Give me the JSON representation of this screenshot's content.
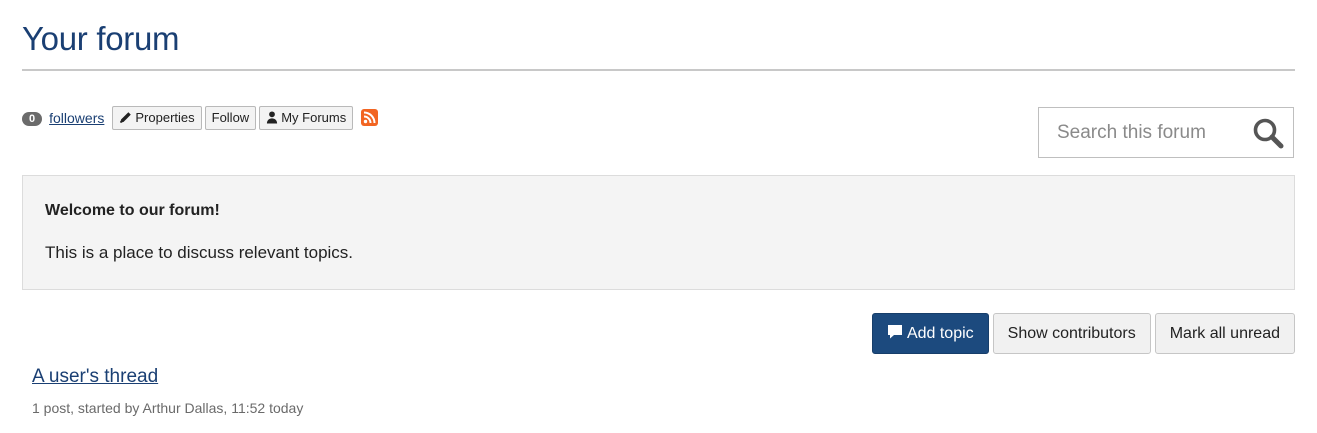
{
  "forum": {
    "title": "Your forum"
  },
  "toolbar": {
    "follower_count": "0",
    "followers_label": "followers",
    "properties_label": "Properties",
    "follow_label": "Follow",
    "my_forums_label": "My Forums",
    "rss_icon": "rss-icon"
  },
  "search": {
    "placeholder": "Search this forum",
    "value": "",
    "icon": "search-icon"
  },
  "intro": {
    "heading": "Welcome to our forum!",
    "text": "This is a place to discuss relevant topics."
  },
  "actions": {
    "add_topic_label": "Add topic",
    "show_contributors_label": "Show contributors",
    "mark_all_unread_label": "Mark all unread"
  },
  "threads": [
    {
      "title": "A user's thread",
      "meta": "1 post, started by Arthur Dallas, 11:52 today"
    }
  ],
  "colors": {
    "accent": "#1c4a7e",
    "title": "#1a3f73",
    "rss": "#f26522"
  }
}
